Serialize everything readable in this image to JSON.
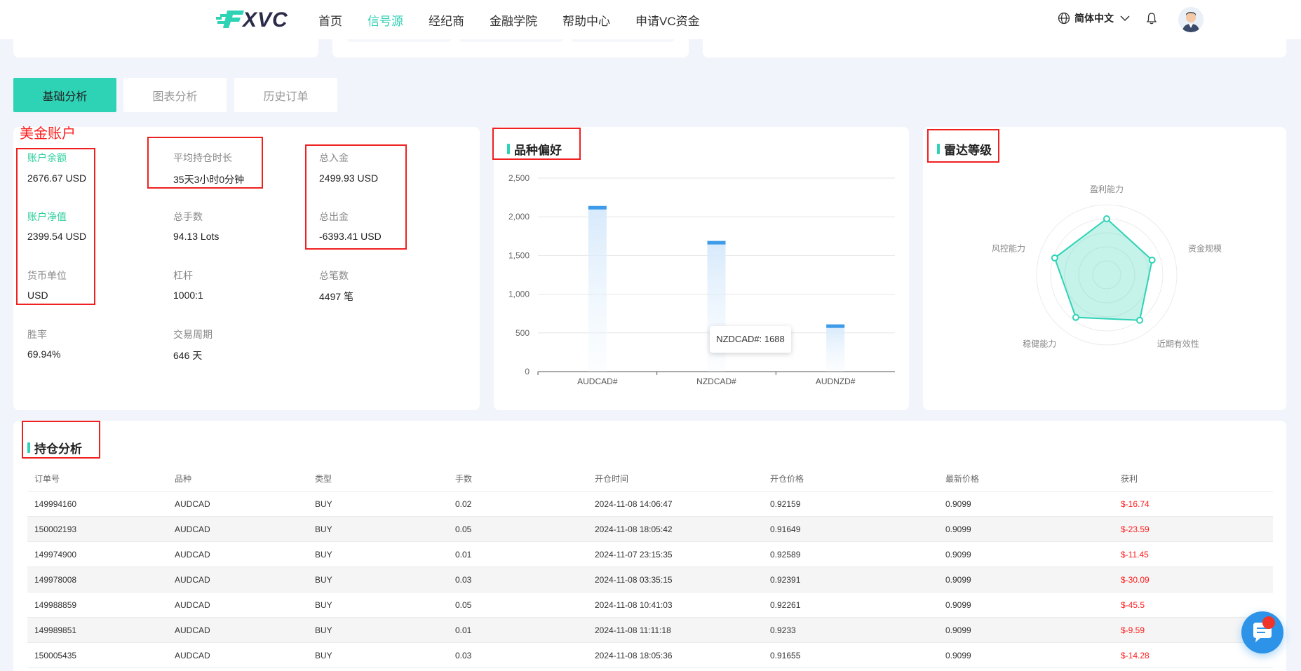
{
  "header": {
    "logo_text": "XVC",
    "nav": [
      {
        "label": "首页",
        "active": false
      },
      {
        "label": "信号源",
        "active": true
      },
      {
        "label": "经纪商",
        "active": false
      },
      {
        "label": "金融学院",
        "active": false
      },
      {
        "label": "帮助中心",
        "active": false
      },
      {
        "label": "申请VC资金",
        "active": false
      }
    ],
    "language": "简体中文"
  },
  "tabs": [
    {
      "label": "基础分析",
      "active": true
    },
    {
      "label": "图表分析",
      "active": false
    },
    {
      "label": "历史订单",
      "active": false
    }
  ],
  "account": {
    "title": "美金账户",
    "stats": {
      "balance": {
        "label": "账户余额",
        "value": "2676.67 USD"
      },
      "avg_hold": {
        "label": "平均持仓时长",
        "value": "35天3小时0分钟"
      },
      "total_in": {
        "label": "总入金",
        "value": "2499.93 USD"
      },
      "equity": {
        "label": "账户净值",
        "value": "2399.54 USD"
      },
      "lots": {
        "label": "总手数",
        "value": "94.13 Lots"
      },
      "total_out": {
        "label": "总出金",
        "value": "-6393.41 USD"
      },
      "currency": {
        "label": "货币单位",
        "value": "USD"
      },
      "leverage": {
        "label": "杠杆",
        "value": "1000:1"
      },
      "trades": {
        "label": "总笔数",
        "value": "4497 笔"
      },
      "win_rate": {
        "label": "胜率",
        "value": "69.94%"
      },
      "period": {
        "label": "交易周期",
        "value": "646 天"
      }
    }
  },
  "preference": {
    "title": "品种偏好",
    "tooltip": "NZDCAD#: 1688"
  },
  "radar": {
    "title": "雷达等级"
  },
  "chart_data": [
    {
      "type": "bar",
      "title": "品种偏好",
      "categories": [
        "AUDCAD#",
        "NZDCAD#",
        "AUDNZD#"
      ],
      "values": [
        2140,
        1688,
        610
      ],
      "yticks": [
        "0",
        "500",
        "1,000",
        "1,500",
        "2,000",
        "2,500"
      ],
      "ylim": [
        0,
        2500
      ],
      "grid": true
    },
    {
      "type": "radar",
      "title": "雷达等级",
      "indicators": [
        "盈利能力",
        "资金规模",
        "近期有效性",
        "稳健能力",
        "风控能力"
      ],
      "max": 100,
      "values": [
        80,
        68,
        80,
        75,
        78
      ],
      "color": "#2ed3b5"
    }
  ],
  "positions": {
    "title": "持仓分析",
    "columns": [
      "订单号",
      "品种",
      "类型",
      "手数",
      "开仓时间",
      "开仓价格",
      "最新价格",
      "获利"
    ],
    "rows": [
      [
        "149994160",
        "AUDCAD",
        "BUY",
        "0.02",
        "2024-11-08 14:06:47",
        "0.92159",
        "0.9099",
        "$-16.74"
      ],
      [
        "150002193",
        "AUDCAD",
        "BUY",
        "0.05",
        "2024-11-08 18:05:42",
        "0.91649",
        "0.9099",
        "$-23.59"
      ],
      [
        "149974900",
        "AUDCAD",
        "BUY",
        "0.01",
        "2024-11-07 23:15:35",
        "0.92589",
        "0.9099",
        "$-11.45"
      ],
      [
        "149978008",
        "AUDCAD",
        "BUY",
        "0.03",
        "2024-11-08 03:35:15",
        "0.92391",
        "0.9099",
        "$-30.09"
      ],
      [
        "149988859",
        "AUDCAD",
        "BUY",
        "0.05",
        "2024-11-08 10:41:03",
        "0.92261",
        "0.9099",
        "$-45.5"
      ],
      [
        "149989851",
        "AUDCAD",
        "BUY",
        "0.01",
        "2024-11-08 11:11:18",
        "0.9233",
        "0.9099",
        "$-9.59"
      ],
      [
        "150005435",
        "AUDCAD",
        "BUY",
        "0.03",
        "2024-11-08 18:05:36",
        "0.91655",
        "0.9099",
        "$-14.28"
      ]
    ]
  },
  "colors": {
    "accent": "#2ed3b5",
    "negative": "#ff1a1a",
    "bar": "#3d9be9",
    "annotation": "#f02020"
  }
}
